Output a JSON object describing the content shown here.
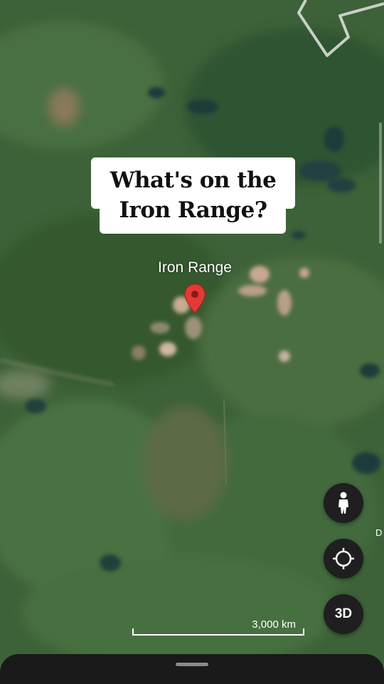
{
  "caption": {
    "line1": "What's on the",
    "line2": "Iron Range?"
  },
  "map": {
    "place_label": "Iron Range",
    "pin_color": "#e53935"
  },
  "scale": {
    "label": "3,000 km"
  },
  "controls": {
    "street_view_icon": "pegman-icon",
    "my_location_icon": "crosshair-icon",
    "three_d_label": "3D"
  },
  "edge_text": "D",
  "colors": {
    "map_green": "#3f6a3c",
    "fab_bg": "#1f1f1f",
    "sheet_bg": "#1a1a1a"
  }
}
